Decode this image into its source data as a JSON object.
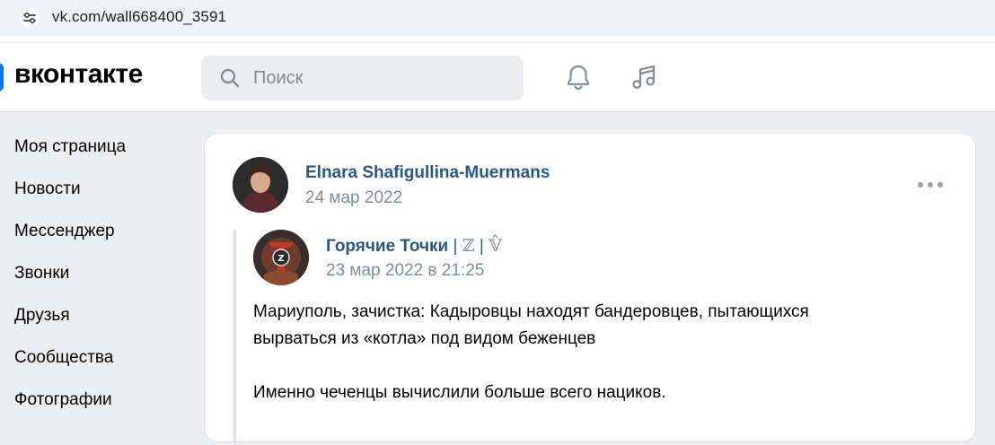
{
  "browser": {
    "url": "vk.com/wall668400_3591",
    "site_info_icon": "tune-icon"
  },
  "header": {
    "logo_text": "вконтакте",
    "search_placeholder": "Поиск",
    "search_icon": "search-icon",
    "notifications_icon": "bell-icon",
    "music_icon": "music-note-icon",
    "accent_color": "#0077ff"
  },
  "sidebar": {
    "items": [
      {
        "label": "Моя страница"
      },
      {
        "label": "Новости"
      },
      {
        "label": "Мессенджер"
      },
      {
        "label": "Звонки"
      },
      {
        "label": "Друзья"
      },
      {
        "label": "Сообщества"
      },
      {
        "label": "Фотографии"
      }
    ]
  },
  "post": {
    "author_name": "Elnara Shafigullina-Muermans",
    "date": "24 мар 2022",
    "more_icon": "more-horizontal-icon",
    "repost": {
      "source_name": "Горячие Точки",
      "source_separator_1": "|",
      "source_mark_1": "ℤ",
      "source_separator_2": "|",
      "source_mark_2": "𝕍̂",
      "source_datetime": "23 мар 2022 в 21:25",
      "paragraph_1_line_1": "Мариуполь, зачистка: Кадыровцы находят бандеровцев, пытающихся",
      "paragraph_1_line_2": "вырваться из «котла» под видом беженцев",
      "paragraph_2": "Именно чеченцы вычислили больше всего нациков."
    }
  },
  "colors": {
    "link": "#2a5885",
    "secondary_text": "#818c99",
    "page_background": "#edeef0"
  }
}
